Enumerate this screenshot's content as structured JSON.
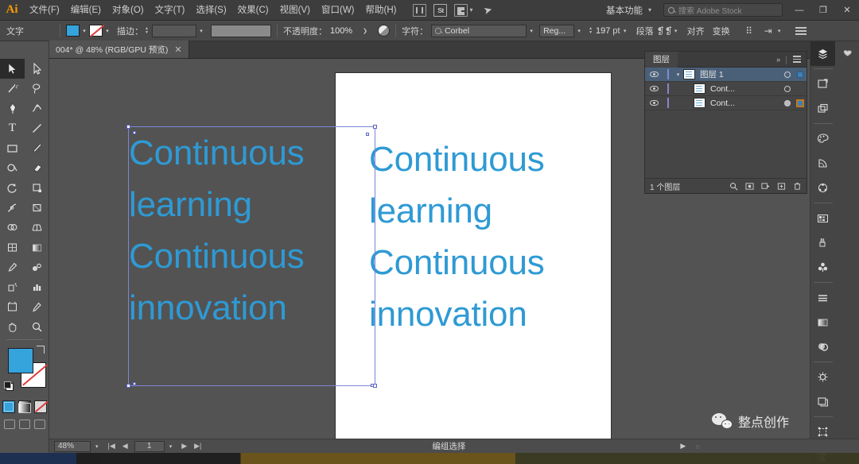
{
  "app": {
    "name": "Adobe Illustrator",
    "logo": "Ai"
  },
  "menubar": {
    "items": [
      "文件(F)",
      "编辑(E)",
      "对象(O)",
      "文字(T)",
      "选择(S)",
      "效果(C)",
      "视图(V)",
      "窗口(W)",
      "帮助(H)"
    ],
    "icons": [
      "document-icon",
      "adobe-stock-icon",
      "arrange-documents-icon",
      "discover-rocket-icon"
    ],
    "stock_label": "St",
    "workspace": "基本功能",
    "search_placeholder": "搜索 Adobe Stock",
    "window_controls": [
      "—",
      "❐",
      "✕"
    ]
  },
  "controlbar": {
    "tool_label": "文字",
    "fill_color": "#35a3dc",
    "stroke_color": "none",
    "stroke_label": "描边：",
    "stroke_weight": "",
    "opacity_label": "不透明度：",
    "opacity_value": "100%",
    "character_label": "字符：",
    "font_family": "Corbel",
    "font_style": "Reg...",
    "font_size": "197",
    "font_size_unit": "pt",
    "paragraph_label": "段落",
    "align_label": "对齐",
    "transform_label": "变换"
  },
  "tab": {
    "title": "004* @ 48% (RGB/GPU 预览)",
    "close": "✕"
  },
  "toolbar": {
    "tools": [
      "selection-tool",
      "direct-selection-tool",
      "magic-wand-tool",
      "lasso-tool",
      "pen-tool",
      "curvature-tool",
      "type-tool",
      "line-segment-tool",
      "rectangle-tool",
      "paintbrush-tool",
      "shaper-tool",
      "eraser-tool",
      "rotate-tool",
      "scale-tool",
      "width-tool",
      "free-transform-tool",
      "shape-builder-tool",
      "perspective-grid-tool",
      "mesh-tool",
      "gradient-tool",
      "eyedropper-tool",
      "blend-tool",
      "symbol-sprayer-tool",
      "column-graph-tool",
      "artboard-tool",
      "slice-tool",
      "hand-tool",
      "zoom-tool"
    ],
    "type_tool_glyph": "T",
    "fill_swatch": "#35a3dc",
    "stroke_swatch": "none",
    "color_modes": [
      "color-mode",
      "gradient-mode",
      "none-mode"
    ],
    "screen_modes": [
      "normal-screen-mode",
      "full-screen-menu-mode",
      "full-screen-mode"
    ]
  },
  "canvas": {
    "artboard_text": "Continuous learning Continuous innovation",
    "artboard_lines": [
      "Continuous",
      " learning",
      "Continuous",
      " innovation"
    ],
    "selected_text_lines": [
      "Continuous",
      " learning",
      "Continuous",
      " innovation"
    ],
    "text_color": "#2e9ad4",
    "artboard_background": "#ffffff",
    "canvas_background": "#535353",
    "selection_color": "#7e86d8"
  },
  "layers_panel": {
    "title": "图层",
    "collapse_icon": "»",
    "menu_icon": "panel-menu-icon",
    "rows": [
      {
        "name": "图层 1",
        "selected": true,
        "visible": true,
        "locked": false,
        "expanded": true
      },
      {
        "name": "Cont...",
        "selected": false,
        "visible": true,
        "locked": false,
        "expanded": false
      },
      {
        "name": "Cont...",
        "selected": true,
        "visible": true,
        "locked": false,
        "expanded": false
      }
    ],
    "footer_count": "1 个图层",
    "footer_icons": [
      "locate-object-icon",
      "make-mask-icon",
      "create-sublayer-icon",
      "new-layer-icon",
      "delete-layer-icon"
    ]
  },
  "rail": {
    "icons": [
      "layers-icon",
      "libraries-icon",
      "artboards-icon",
      "asset-export-icon",
      "color-icon",
      "color-guide-icon",
      "color-themes-icon",
      "swatches-icon",
      "brushes-icon",
      "symbols-icon",
      "stroke-icon",
      "gradient-icon",
      "transparency-icon",
      "appearance-icon",
      "graphic-styles-icon",
      "transform-icon",
      "align-icon",
      "pathfinder-icon"
    ]
  },
  "statusbar": {
    "zoom": "48%",
    "page": "1",
    "tool_status": "编组选择",
    "nav_first": "|◀",
    "nav_prev": "◀",
    "nav_next": "▶",
    "nav_last": "▶|",
    "play": "▶"
  },
  "watermark": {
    "text": "整点创作",
    "icon": "wechat-icon"
  }
}
